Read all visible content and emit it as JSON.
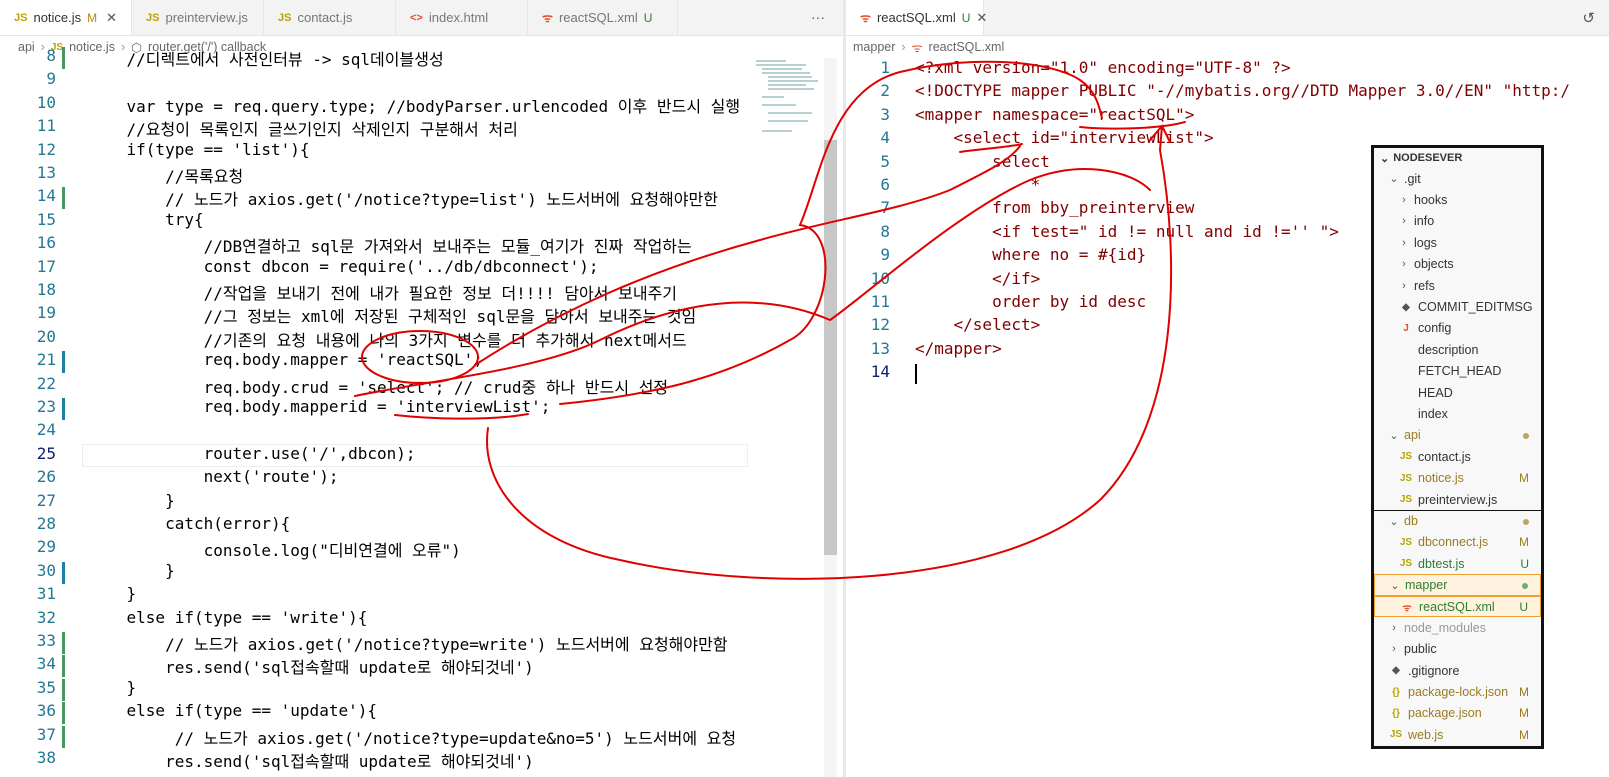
{
  "left": {
    "tabs": [
      {
        "icon": "JS",
        "name": "notice.js",
        "status": "M",
        "active": true
      },
      {
        "icon": "JS",
        "name": "preinterview.js",
        "status": "",
        "active": false
      },
      {
        "icon": "JS",
        "name": "contact.js",
        "status": "",
        "active": false
      },
      {
        "icon": "<>",
        "name": "index.html",
        "status": "",
        "active": false
      },
      {
        "icon": "xml",
        "name": "reactSQL.xml",
        "status": "U",
        "active": false
      }
    ],
    "more": "···",
    "breadcrumb": [
      "api",
      "notice.js",
      "router.get('/') callback"
    ],
    "lines": [
      {
        "n": "8",
        "t": "    //디렉트에서 사전인터뷰 -> sql데이블생성"
      },
      {
        "n": "9",
        "t": ""
      },
      {
        "n": "10",
        "t": "    var type = req.query.type; //bodyParser.urlencoded 이후 반드시 실행"
      },
      {
        "n": "11",
        "t": "    //요청이 목록인지 글쓰기인지 삭제인지 구분해서 처리"
      },
      {
        "n": "12",
        "t": "    if(type == 'list'){"
      },
      {
        "n": "13",
        "t": "        //목록요청"
      },
      {
        "n": "14",
        "t": "        // 노드가 axios.get('/notice?type=list') 노드서버에 요청해야만한"
      },
      {
        "n": "15",
        "t": "        try{"
      },
      {
        "n": "16",
        "t": "            //DB연결하고 sql문 가져와서 보내주는 모듈_여기가 진짜 작업하는"
      },
      {
        "n": "17",
        "t": "            const dbcon = require('../db/dbconnect');"
      },
      {
        "n": "18",
        "t": "            //작업을 보내기 전에 내가 필요한 정보 더!!!! 담아서 보내주기"
      },
      {
        "n": "19",
        "t": "            //그 정보는 xml에 저장된 구체적인 sql문을 담아서 보내주는 것임"
      },
      {
        "n": "20",
        "t": "            //기존의 요청 내용에 나의 3가지 변수를 더 추가해서 next메서드"
      },
      {
        "n": "21",
        "t": "            req.body.mapper = 'reactSQL';"
      },
      {
        "n": "22",
        "t": "            req.body.crud = 'select'; // crud중 하나 반드시 선정"
      },
      {
        "n": "23",
        "t": "            req.body.mapperid = 'interviewList';"
      },
      {
        "n": "24",
        "t": ""
      },
      {
        "n": "25",
        "t": "            router.use('/',dbcon);"
      },
      {
        "n": "26",
        "t": "            next('route');"
      },
      {
        "n": "27",
        "t": "        }"
      },
      {
        "n": "28",
        "t": "        catch(error){"
      },
      {
        "n": "29",
        "t": "            console.log(\"디비연결에 오류\")"
      },
      {
        "n": "30",
        "t": "        }"
      },
      {
        "n": "31",
        "t": "    }"
      },
      {
        "n": "32",
        "t": "    else if(type == 'write'){"
      },
      {
        "n": "33",
        "t": "        // 노드가 axios.get('/notice?type=write') 노드서버에 요청해야만함"
      },
      {
        "n": "34",
        "t": "        res.send('sql접속할때 update로 해야되것네')"
      },
      {
        "n": "35",
        "t": "    }"
      },
      {
        "n": "36",
        "t": "    else if(type == 'update'){"
      },
      {
        "n": "37",
        "t": "         // 노드가 axios.get('/notice?type=update&no=5') 노드서버에 요청"
      },
      {
        "n": "38",
        "t": "        res.send('sql접속할때 update로 해야되것네')"
      }
    ]
  },
  "right": {
    "tab": {
      "icon": "xml",
      "name": "reactSQL.xml",
      "status": "U"
    },
    "breadcrumb": [
      "mapper",
      "reactSQL.xml"
    ],
    "lines": [
      {
        "n": "1",
        "t": "<?xml version=\"1.0\" encoding=\"UTF-8\" ?>"
      },
      {
        "n": "2",
        "t": "<!DOCTYPE mapper PUBLIC \"-//mybatis.org//DTD Mapper 3.0//EN\" \"http:/"
      },
      {
        "n": "3",
        "t": "<mapper namespace=\"reactSQL\">"
      },
      {
        "n": "4",
        "t": "    <select id=\"interviewList\">"
      },
      {
        "n": "5",
        "t": "        select"
      },
      {
        "n": "6",
        "t": "            *"
      },
      {
        "n": "7",
        "t": "        from bby_preinterview"
      },
      {
        "n": "8",
        "t": "        <if test=\" id != null and id !='' \">"
      },
      {
        "n": "9",
        "t": "        where no = #{id}"
      },
      {
        "n": "10",
        "t": "        </if>"
      },
      {
        "n": "11",
        "t": "        order by id desc"
      },
      {
        "n": "12",
        "t": "    </select>"
      },
      {
        "n": "13",
        "t": "</mapper>"
      },
      {
        "n": "14",
        "t": ""
      }
    ]
  },
  "explorer": {
    "title": "NODESEVER",
    "items": [
      {
        "label": ".git",
        "kind": "folder",
        "open": true,
        "depth": 1,
        "status": ""
      },
      {
        "label": "hooks",
        "kind": "folder",
        "open": false,
        "depth": 2,
        "status": ""
      },
      {
        "label": "info",
        "kind": "folder",
        "open": false,
        "depth": 2,
        "status": ""
      },
      {
        "label": "logs",
        "kind": "folder",
        "open": false,
        "depth": 2,
        "status": ""
      },
      {
        "label": "objects",
        "kind": "folder",
        "open": false,
        "depth": 2,
        "status": ""
      },
      {
        "label": "refs",
        "kind": "folder",
        "open": false,
        "depth": 2,
        "status": ""
      },
      {
        "label": "COMMIT_EDITMSG",
        "kind": "git",
        "depth": 2,
        "status": ""
      },
      {
        "label": "config",
        "kind": "config",
        "depth": 2,
        "status": ""
      },
      {
        "label": "description",
        "kind": "file",
        "depth": 2,
        "status": ""
      },
      {
        "label": "FETCH_HEAD",
        "kind": "file",
        "depth": 2,
        "status": ""
      },
      {
        "label": "HEAD",
        "kind": "file",
        "depth": 2,
        "status": ""
      },
      {
        "label": "index",
        "kind": "file",
        "depth": 2,
        "status": ""
      },
      {
        "label": "api",
        "kind": "folder",
        "open": true,
        "depth": 1,
        "status": "dot"
      },
      {
        "label": "contact.js",
        "kind": "js",
        "depth": 2,
        "status": ""
      },
      {
        "label": "notice.js",
        "kind": "js",
        "depth": 2,
        "status": "M"
      },
      {
        "label": "preinterview.js",
        "kind": "js",
        "depth": 2,
        "status": ""
      },
      {
        "label": "db",
        "kind": "folder",
        "open": true,
        "depth": 1,
        "status": "dot"
      },
      {
        "label": "dbconnect.js",
        "kind": "js",
        "depth": 2,
        "status": "M"
      },
      {
        "label": "dbtest.js",
        "kind": "js",
        "depth": 2,
        "status": "U"
      },
      {
        "label": "mapper",
        "kind": "folder",
        "open": true,
        "depth": 1,
        "status": "gdot"
      },
      {
        "label": "reactSQL.xml",
        "kind": "xml",
        "depth": 2,
        "status": "U"
      },
      {
        "label": "node_modules",
        "kind": "folder",
        "open": false,
        "depth": 1,
        "status": ""
      },
      {
        "label": "public",
        "kind": "folder",
        "open": false,
        "depth": 1,
        "status": ""
      },
      {
        "label": ".gitignore",
        "kind": "git",
        "depth": 1,
        "status": ""
      },
      {
        "label": "package-lock.json",
        "kind": "json",
        "depth": 1,
        "status": "M"
      },
      {
        "label": "package.json",
        "kind": "json",
        "depth": 1,
        "status": "M"
      },
      {
        "label": "web.js",
        "kind": "js",
        "depth": 1,
        "status": "M"
      }
    ]
  },
  "colors": {
    "annotation": "#e00000",
    "modified": "#b58900",
    "untracked": "#2e7d32"
  }
}
